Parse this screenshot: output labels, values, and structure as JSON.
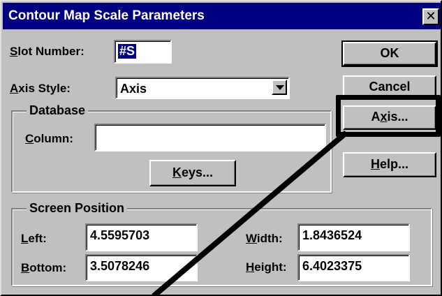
{
  "dialog": {
    "title": "Contour Map Scale Parameters",
    "close_glyph": "✕"
  },
  "slot_number": {
    "label_hotkey": "S",
    "label_rest": "lot Number:",
    "value": "#S"
  },
  "axis_style": {
    "label_hotkey": "A",
    "label_rest": "xis Style:",
    "value": "Axis"
  },
  "database": {
    "title": "Database",
    "column_label_hotkey": "C",
    "column_label_rest": "olumn:",
    "column_value": "",
    "keys_hotkey": "K",
    "keys_rest": "eys..."
  },
  "buttons": {
    "ok": "OK",
    "cancel": "Cancel",
    "axis_pre": "A",
    "axis_hotkey": "x",
    "axis_rest": "is...",
    "help_hotkey": "H",
    "help_rest": "elp..."
  },
  "screen_position": {
    "title": "Screen Position",
    "left_hotkey": "L",
    "left_rest": "eft:",
    "left_value": "4.5595703",
    "bottom_hotkey": "B",
    "bottom_rest": "ottom:",
    "bottom_value": "3.5078246",
    "width_hotkey": "W",
    "width_rest": "idth:",
    "width_value": "1.8436524",
    "height_hotkey": "H",
    "height_rest": "eight:",
    "height_value": "6.4023375"
  },
  "colors": {
    "title_bar": "#000080",
    "dialog_face": "#c0c0c0",
    "annotation": "#000000"
  }
}
